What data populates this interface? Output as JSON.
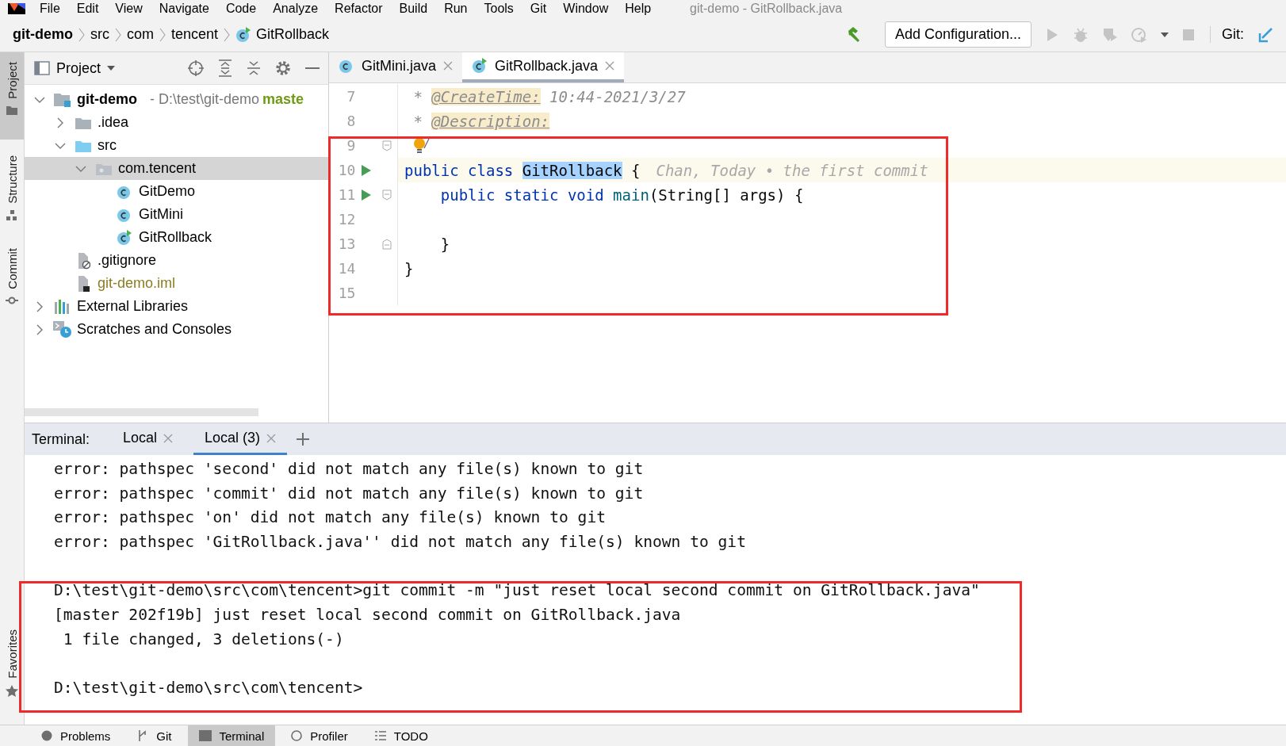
{
  "menu": [
    "File",
    "Edit",
    "View",
    "Navigate",
    "Code",
    "Analyze",
    "Refactor",
    "Build",
    "Run",
    "Tools",
    "Git",
    "Window",
    "Help"
  ],
  "window_title": "git-demo - GitRollback.java",
  "breadcrumbs": [
    {
      "label": "git-demo",
      "kind": "project"
    },
    {
      "label": "src",
      "kind": "folder"
    },
    {
      "label": "com",
      "kind": "folder"
    },
    {
      "label": "tencent",
      "kind": "folder"
    },
    {
      "label": "GitRollback",
      "kind": "class"
    }
  ],
  "toolbar": {
    "run_config": "Add Configuration...",
    "git_label": "Git:"
  },
  "side_stripe": [
    {
      "label": "Project",
      "selected": true,
      "kind": "folder"
    },
    {
      "label": "Structure",
      "selected": false,
      "kind": "structure"
    },
    {
      "label": "Commit",
      "selected": false,
      "kind": "commit"
    },
    {
      "label": "Favorites",
      "selected": false,
      "kind": "star"
    }
  ],
  "project_panel": {
    "title": "Project",
    "tree": [
      {
        "label": "git-demo",
        "kind": "module",
        "expanded": true,
        "selected": false,
        "path": "- D:\\test\\git-demo",
        "branch": "maste",
        "children": [
          {
            "label": ".idea",
            "kind": "folder",
            "expanded": false,
            "selected": false
          },
          {
            "label": "src",
            "kind": "source",
            "expanded": true,
            "selected": false,
            "children": [
              {
                "label": "com.tencent",
                "kind": "package",
                "expanded": true,
                "selected": true,
                "children": [
                  {
                    "label": "GitDemo",
                    "kind": "class",
                    "selected": false
                  },
                  {
                    "label": "GitMini",
                    "kind": "class",
                    "selected": false
                  },
                  {
                    "label": "GitRollback",
                    "kind": "runnable-class",
                    "selected": false
                  }
                ]
              }
            ]
          },
          {
            "label": ".gitignore",
            "kind": "ignore-file",
            "selected": false
          },
          {
            "label": "git-demo.iml",
            "kind": "iml-file",
            "selected": false
          }
        ]
      },
      {
        "label": "External Libraries",
        "kind": "libraries",
        "expanded": false,
        "selected": false
      },
      {
        "label": "Scratches and Consoles",
        "kind": "scratches",
        "expanded": false,
        "selected": false
      }
    ]
  },
  "editor_tabs": [
    {
      "label": "GitMini.java",
      "kind": "class",
      "selected": false
    },
    {
      "label": "GitRollback.java",
      "kind": "runnable-class",
      "selected": true
    }
  ],
  "code_lines": [
    {
      "number": "7",
      "tokens": [
        {
          "kind": "comment",
          "text": " * "
        },
        {
          "kind": "doctag",
          "text": "@CreateTime:"
        },
        {
          "kind": "comment",
          "text": " 10:44-2021/3/27"
        }
      ]
    },
    {
      "number": "8",
      "tokens": [
        {
          "kind": "comment",
          "text": " * "
        },
        {
          "kind": "doctag",
          "text": "@Description:"
        }
      ]
    },
    {
      "number": "9",
      "fold_open": true,
      "bulb": true
    },
    {
      "number": "10",
      "run": true,
      "current": true,
      "tokens": [
        {
          "kind": "keyword",
          "text": "public class "
        },
        {
          "kind": "highlight",
          "text": "GitRollback"
        },
        {
          "kind": "plain",
          "text": " {"
        },
        {
          "kind": "hint",
          "text": "Chan, Today • the first commit"
        }
      ]
    },
    {
      "number": "11",
      "run": true,
      "fold_open": true,
      "tokens": [
        {
          "kind": "keyword",
          "text": "    public static void "
        },
        {
          "kind": "method",
          "text": "main"
        },
        {
          "kind": "plain",
          "text": "(String[] args) {"
        }
      ]
    },
    {
      "number": "12"
    },
    {
      "number": "13",
      "fold_close": true,
      "tokens": [
        {
          "kind": "plain",
          "text": "    }"
        }
      ]
    },
    {
      "number": "14",
      "tokens": [
        {
          "kind": "plain",
          "text": "}"
        }
      ]
    },
    {
      "number": "15"
    }
  ],
  "terminal": {
    "title": "Terminal:",
    "tabs": [
      {
        "label": "Local",
        "selected": false
      },
      {
        "label": "Local (3)",
        "selected": true
      }
    ],
    "blocks": [
      [
        "error: pathspec 'second' did not match any file(s) known to git",
        "error: pathspec 'commit' did not match any file(s) known to git",
        "error: pathspec 'on' did not match any file(s) known to git",
        "error: pathspec 'GitRollback.java'' did not match any file(s) known to git"
      ],
      [
        "D:\\test\\git-demo\\src\\com\\tencent>git commit -m \"just reset local second commit on GitRollback.java\"",
        "[master 202f19b] just reset local second commit on GitRollback.java",
        " 1 file changed, 3 deletions(-)"
      ],
      [
        "D:\\test\\git-demo\\src\\com\\tencent>"
      ]
    ]
  },
  "bottom_tabs": [
    {
      "label": "Problems",
      "kind": "problems",
      "selected": false
    },
    {
      "label": "Git",
      "kind": "git",
      "selected": false
    },
    {
      "label": "Terminal",
      "kind": "terminal",
      "selected": true
    },
    {
      "label": "Profiler",
      "kind": "profiler",
      "selected": false
    },
    {
      "label": "TODO",
      "kind": "todo",
      "selected": false
    }
  ],
  "editor_frame": true,
  "terminal_frame": true
}
